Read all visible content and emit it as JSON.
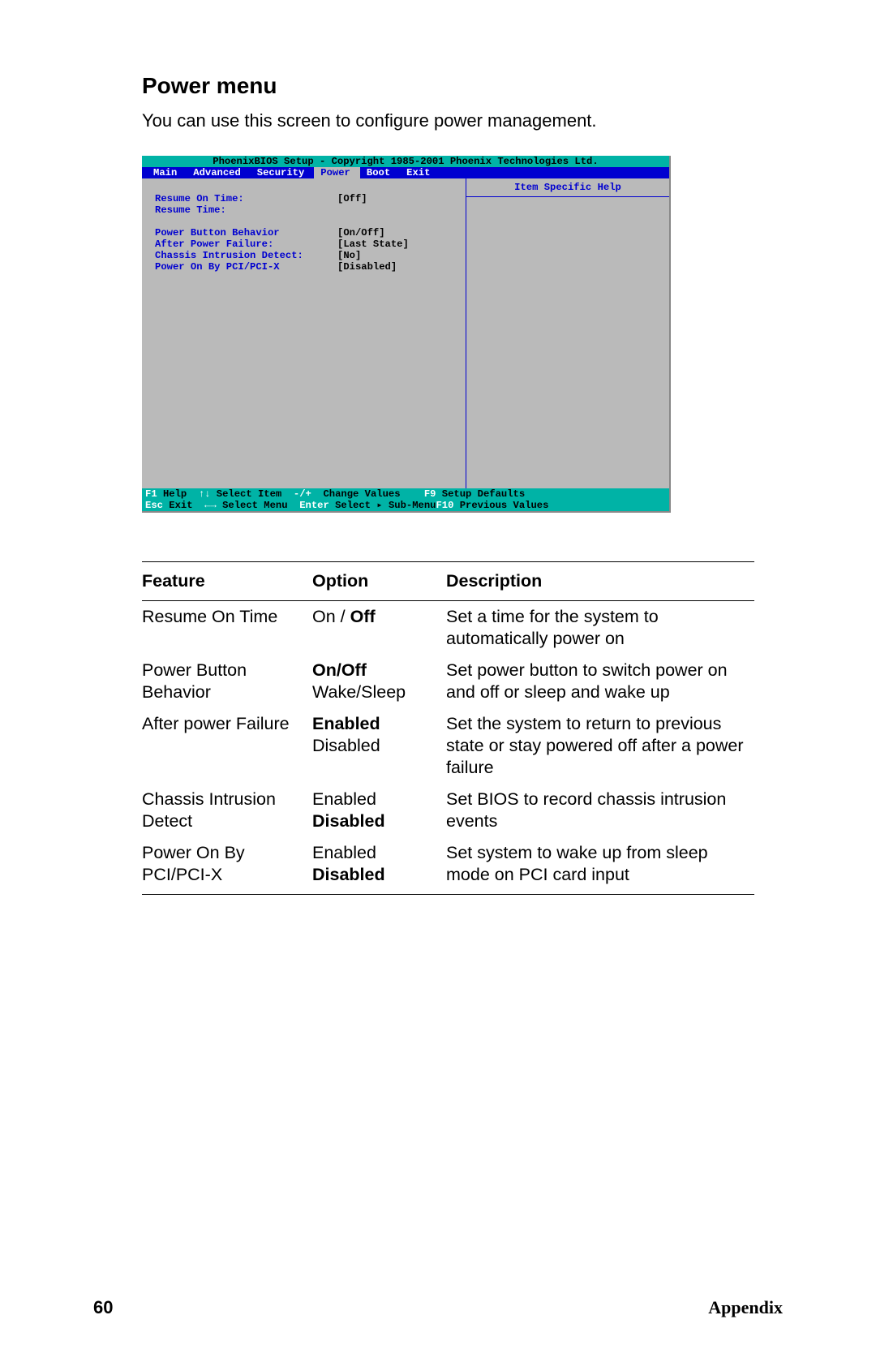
{
  "heading": "Power menu",
  "subtext": "You can use this screen to configure power management.",
  "bios": {
    "title": "PhoenixBIOS Setup - Copyright 1985-2001 Phoenix Technologies Ltd.",
    "menus": [
      "Main",
      "Advanced",
      "Security",
      "Power",
      "Boot",
      "Exit"
    ],
    "active_menu": "Power",
    "help_title": "Item Specific Help",
    "items": [
      {
        "label": "Resume On Time:",
        "value": "[Off]"
      },
      {
        "label": "Resume Time:",
        "value": ""
      },
      {
        "spacer": true
      },
      {
        "label": "Power Button Behavior",
        "value": "[On/Off]"
      },
      {
        "label": "After Power Failure:",
        "value": "[Last State]"
      },
      {
        "label": "Chassis Intrusion Detect:",
        "value": "[No]"
      },
      {
        "label": "Power On By PCI/PCI-X",
        "value": "[Disabled]"
      }
    ],
    "footer": {
      "l1": {
        "a": "F1 ",
        "b": "Help  ",
        "c": "↑↓",
        "d": " Select Item  ",
        "e": "-/+  ",
        "f": "Change Values    ",
        "g": "F9 ",
        "h": "Setup Defaults"
      },
      "l2": {
        "a": "Esc ",
        "b": "Exit  ",
        "c": "←→",
        "d": " Select Menu  ",
        "e": "Enter ",
        "f": "Select ▸ Sub-Menu",
        "g": "F10 ",
        "h": "Previous Values"
      }
    }
  },
  "table": {
    "headers": {
      "feature": "Feature",
      "option": "Option",
      "description": "Description"
    },
    "rows": [
      {
        "feature": "Resume On Time",
        "option_html": "On / <b>Off</b>",
        "desc": "Set a time for the system to automatically power on"
      },
      {
        "feature": "Power Button Behavior",
        "option_html": "<b>On/Off</b><br>Wake/Sleep",
        "desc": "Set power button to switch power on and off or sleep and wake up"
      },
      {
        "feature": "After power Failure",
        "option_html": "<b>Enabled</b><br>Disabled",
        "desc": "Set the system to return to previous state or stay powered off after a power failure"
      },
      {
        "feature": "Chassis Intrusion Detect",
        "option_html": "Enabled<br><b>Disabled</b>",
        "desc": "Set BIOS to record chassis intru­sion events"
      },
      {
        "feature": "Power On By PCI/PCI-X",
        "option_html": "Enabled<br><b>Disabled</b>",
        "desc": "Set system to wake up from sleep mode on PCI card input"
      }
    ]
  },
  "footer": {
    "page": "60",
    "section": "Appendix"
  }
}
